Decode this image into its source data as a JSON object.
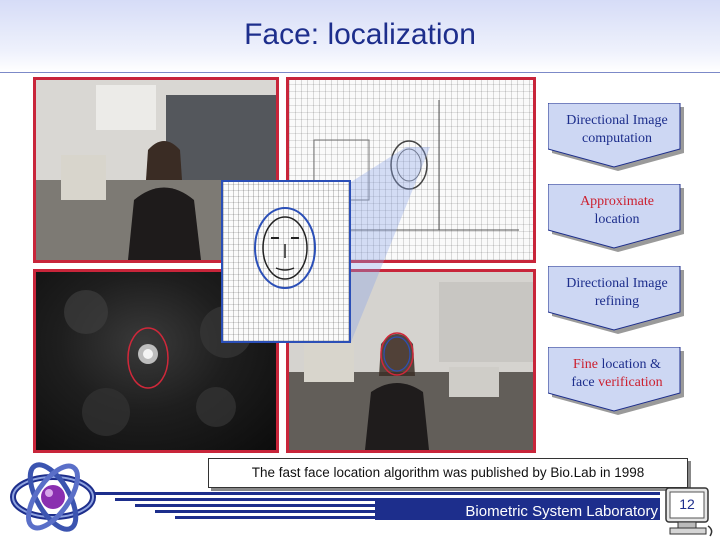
{
  "slide": {
    "title": "Face: localization",
    "caption": "The fast face location algorithm was published by Bio.Lab in 1998",
    "footer": "Biometric System Laboratory",
    "page_number": "12"
  },
  "steps": [
    {
      "line1": "Directional Image",
      "line2": "computation"
    },
    {
      "line1": "Approximate",
      "line2": "location"
    },
    {
      "line1": "Directional Image",
      "line2": "refining"
    },
    {
      "line1_red": "Fine",
      "line1": " location &",
      "line2": "face ",
      "line2_red": "verification"
    }
  ],
  "colors": {
    "title": "#1d2e8c",
    "accent_red": "#cc1f2e",
    "accent_blue": "#2b4fb7"
  },
  "icons": {
    "logo": "atom-orbit-logo",
    "computer": "computer-monitor-icon"
  }
}
